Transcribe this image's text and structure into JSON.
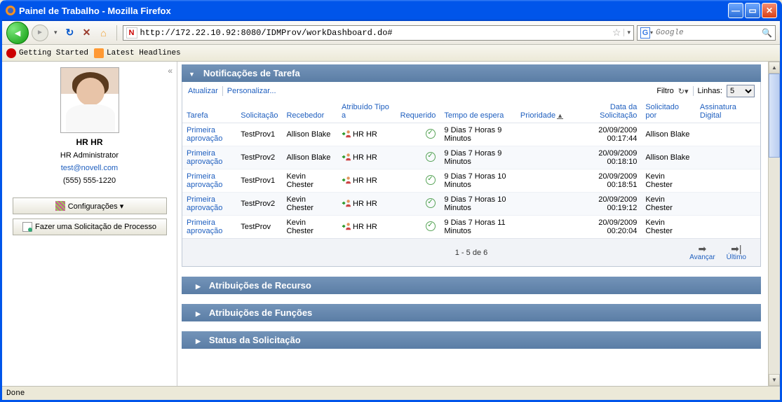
{
  "window": {
    "title": "Painel de Trabalho - Mozilla Firefox"
  },
  "url": "http://172.22.10.92:8080/IDMProv/workDashboard.do#",
  "search": {
    "placeholder": "Google"
  },
  "bookmarks": [
    "Getting Started",
    "Latest Headlines"
  ],
  "status": "Done",
  "user": {
    "name": "HR HR",
    "role": "HR Administrator",
    "email": "test@novell.com",
    "phone": "(555) 555-1220"
  },
  "side_buttons": {
    "settings": "Configurações ▾",
    "request": "Fazer uma Solicitação de Processo"
  },
  "panels": {
    "tasks_title": "Notificações de Tarefa",
    "resources": "Atribuições de Recurso",
    "roles": "Atribuições de Funções",
    "request_status": "Status da Solicitação"
  },
  "task_toolbar": {
    "refresh": "Atualizar",
    "customize": "Personalizar...",
    "filter_label": "Filtro",
    "rows_label": "Linhas:",
    "rows_value": "5"
  },
  "task_headers": {
    "task": "Tarefa",
    "request": "Solicitação",
    "recipient": "Recebedor",
    "assigned": "Atribuído Tipo a",
    "required": "Requerido",
    "wait": "Tempo de espera",
    "priority": "Prioridade",
    "date": "Data da Solicitação",
    "requester": "Solicitado por",
    "signature": "Assinatura Digital"
  },
  "task_rows": [
    {
      "task": "Primeira aprovação",
      "request": "TestProv1",
      "recipient": "Allison Blake",
      "assigned": "HR HR",
      "wait": "9 Dias 7 Horas 9 Minutos",
      "date": "20/09/2009 00:17:44",
      "requester": "Allison Blake"
    },
    {
      "task": "Primeira aprovação",
      "request": "TestProv2",
      "recipient": "Allison Blake",
      "assigned": "HR HR",
      "wait": "9 Dias 7 Horas 9 Minutos",
      "date": "20/09/2009 00:18:10",
      "requester": "Allison Blake"
    },
    {
      "task": "Primeira aprovação",
      "request": "TestProv1",
      "recipient": "Kevin Chester",
      "assigned": "HR HR",
      "wait": "9 Dias 7 Horas 10 Minutos",
      "date": "20/09/2009 00:18:51",
      "requester": "Kevin Chester"
    },
    {
      "task": "Primeira aprovação",
      "request": "TestProv2",
      "recipient": "Kevin Chester",
      "assigned": "HR HR",
      "wait": "9 Dias 7 Horas 10 Minutos",
      "date": "20/09/2009 00:19:12",
      "requester": "Kevin Chester"
    },
    {
      "task": "Primeira aprovação",
      "request": "TestProv",
      "recipient": "Kevin Chester",
      "assigned": "HR HR",
      "wait": "9 Dias 7 Horas 11 Minutos",
      "date": "20/09/2009 00:20:04",
      "requester": "Kevin Chester"
    }
  ],
  "pager": {
    "text": "1 - 5 de 6",
    "next": "Avançar",
    "last": "Último"
  }
}
